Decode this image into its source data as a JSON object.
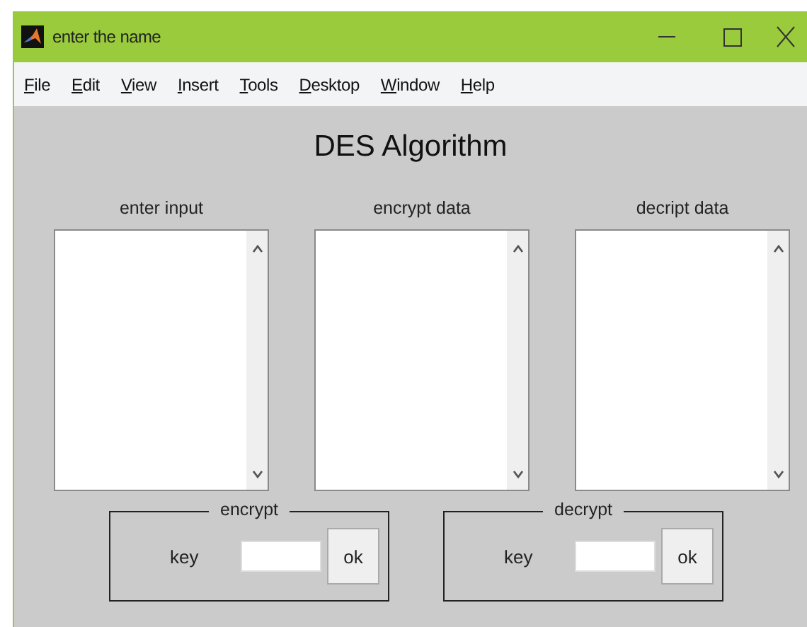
{
  "window": {
    "title": "enter the name"
  },
  "menu": [
    {
      "label": "File",
      "first_letter_underlined": true
    },
    {
      "label": "Edit",
      "first_letter_underlined": true
    },
    {
      "label": "View",
      "first_letter_underlined": true
    },
    {
      "label": "Insert",
      "first_letter_underlined": true
    },
    {
      "label": "Tools",
      "first_letter_underlined": true
    },
    {
      "label": "Desktop",
      "first_letter_underlined": true
    },
    {
      "label": "Window",
      "first_letter_underlined": true
    },
    {
      "label": "Help",
      "first_letter_underlined": true
    }
  ],
  "heading": "DES Algorithm",
  "panes": [
    {
      "label": "enter input"
    },
    {
      "label": "encrypt data"
    },
    {
      "label": "decript data"
    }
  ],
  "groups": [
    {
      "title": "encrypt",
      "key_label": "key",
      "button": "ok"
    },
    {
      "title": "decrypt",
      "key_label": "key",
      "button": "ok"
    }
  ]
}
